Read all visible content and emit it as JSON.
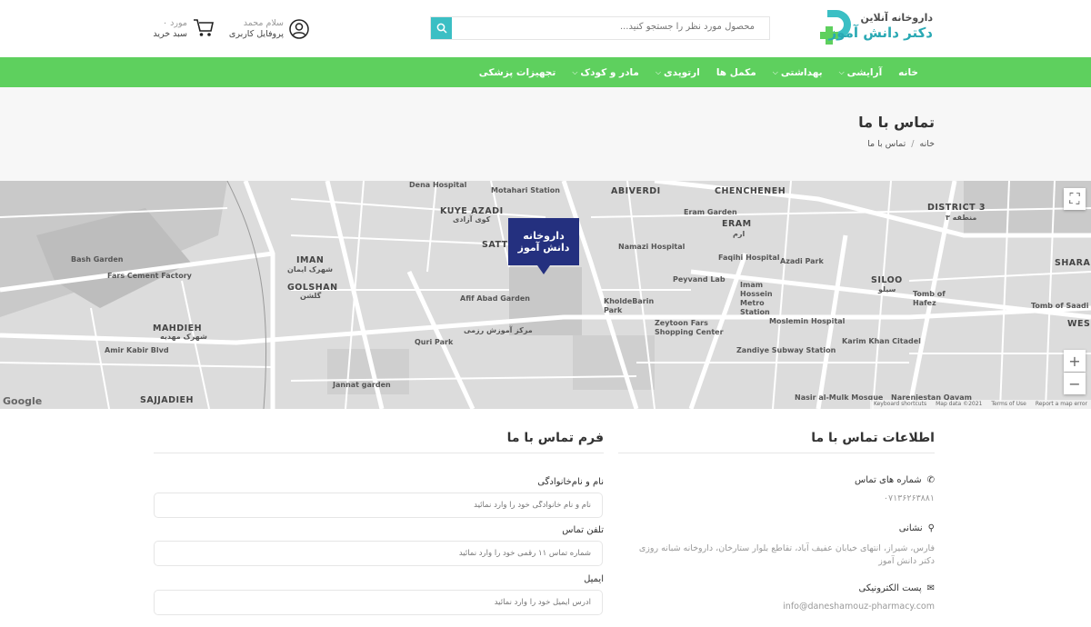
{
  "header": {
    "logo_line1": "داروخانه آنلاین",
    "logo_line2": "دکتر دانش آموز",
    "search_placeholder": "محصول مورد نظر را جستجو کنید...",
    "profile_greeting": "سلام محمد",
    "profile_label": "پروفایل کاربری",
    "cart_count": "۰ مورد",
    "cart_label": "سبد خرید",
    "brand_green": "#5ed05e",
    "brand_teal": "#3bbfc4"
  },
  "nav": {
    "items": [
      {
        "label": "خانه",
        "has_dropdown": false
      },
      {
        "label": "آرایشی",
        "has_dropdown": true
      },
      {
        "label": "بهداشتی",
        "has_dropdown": true
      },
      {
        "label": "مکمل ها",
        "has_dropdown": false
      },
      {
        "label": "ارتوپدی",
        "has_dropdown": true
      },
      {
        "label": "مادر و کودک",
        "has_dropdown": true
      },
      {
        "label": "تجهیزات پزشکی",
        "has_dropdown": false
      }
    ]
  },
  "page": {
    "title": "تماس با ما",
    "breadcrumb_home": "خانه",
    "breadcrumb_sep": "/",
    "breadcrumb_current": "تماس با ما"
  },
  "map": {
    "marker_line1": "داروخانه",
    "marker_line2": "دانش آموز",
    "labels": {
      "abiverdi": "ABIVERDI",
      "chencheneh": "CHENCHENEH",
      "district3": "DISTRICT 3",
      "district3_fa": "منطقه ۳",
      "kuye_azadi": "KUYE AZADI",
      "kuye_azadi_fa": "کوی آزادی",
      "motahari": "Motahari Station",
      "dena": "Dena Hospital",
      "eram_garden": "Eram Garden",
      "eram": "ERAM",
      "eram_fa": "ارم",
      "bash_garden": "Bash Garden",
      "fars_cement": "Fars Cement Factory",
      "iman": "IMAN",
      "iman_fa": "شهرک ایمان",
      "golshan": "GOLSHAN",
      "golshan_fa": "گلشن",
      "mahdieh": "MAHDIEH",
      "mahdieh_fa": "شهرک مهدیه",
      "amir_kabir": "Amir Kabir Blvd",
      "sajjadieh": "SAJJADIEH",
      "satt": "SATT",
      "afif_abad": "Afif Abad Garden",
      "markaz": "مرکز آموزش رزمی",
      "quri_park": "Quri Park",
      "jannat": "Jannat garden",
      "namazi": "Namazi Hospital",
      "faqihi": "Faqihi Hospital",
      "peyvand": "Peyvand Lab",
      "imam_hossein": "Imam Hossein Metro Station",
      "kholde_barin": "KholdeBarin Park",
      "zeytoon": "Zeytoon Fars Shopping Center",
      "moslemin": "Moslemin Hospital",
      "zandiye": "Zandiye Subway Station",
      "karim_khan": "Karim Khan Citadel",
      "nasir": "Nasir al-Mulk Mosque",
      "narenjestan": "Narenjestan Qavam",
      "azadi_park": "Azadi Park",
      "siloo": "SILOO",
      "siloo_fa": "سیلو",
      "tomb_hafez": "Tomb of Hafez",
      "tomb_saadi": "Tomb of Saadi",
      "shara": "SHARA",
      "wes": "WES",
      "google": "Google",
      "keyboard": "Keyboard shortcuts",
      "map_data": "Map data ©2021",
      "terms": "Terms of Use",
      "report": "Report a map error"
    }
  },
  "contact_info": {
    "title": "اطلاعات تماس با ما",
    "phone_label": "شماره های تماس",
    "phone_value": "۰۷۱۳۶۲۶۳۸۸۱",
    "address_label": "نشانی",
    "address_value": "فارس، شیراز، انتهای خیابان عفیف آباد، تقاطع بلوار ستارخان، داروخانه شبانه روزی دکتر دانش آموز",
    "email_label": "پست الکترونیکی",
    "email_value": "info@daneshamouz-pharmacy.com"
  },
  "contact_form": {
    "title": "فرم تماس با ما",
    "name_label": "نام و نام‌خانوادگی",
    "name_placeholder": "نام و نام خانوادگی خود را وارد نمائید",
    "phone_label": "تلفن تماس",
    "phone_placeholder": "شماره تماس ۱۱ رقمی خود را وارد نمائید",
    "email_label": "ایمیل",
    "email_placeholder": "آدرس ایمیل خود را وارد نمائید"
  }
}
